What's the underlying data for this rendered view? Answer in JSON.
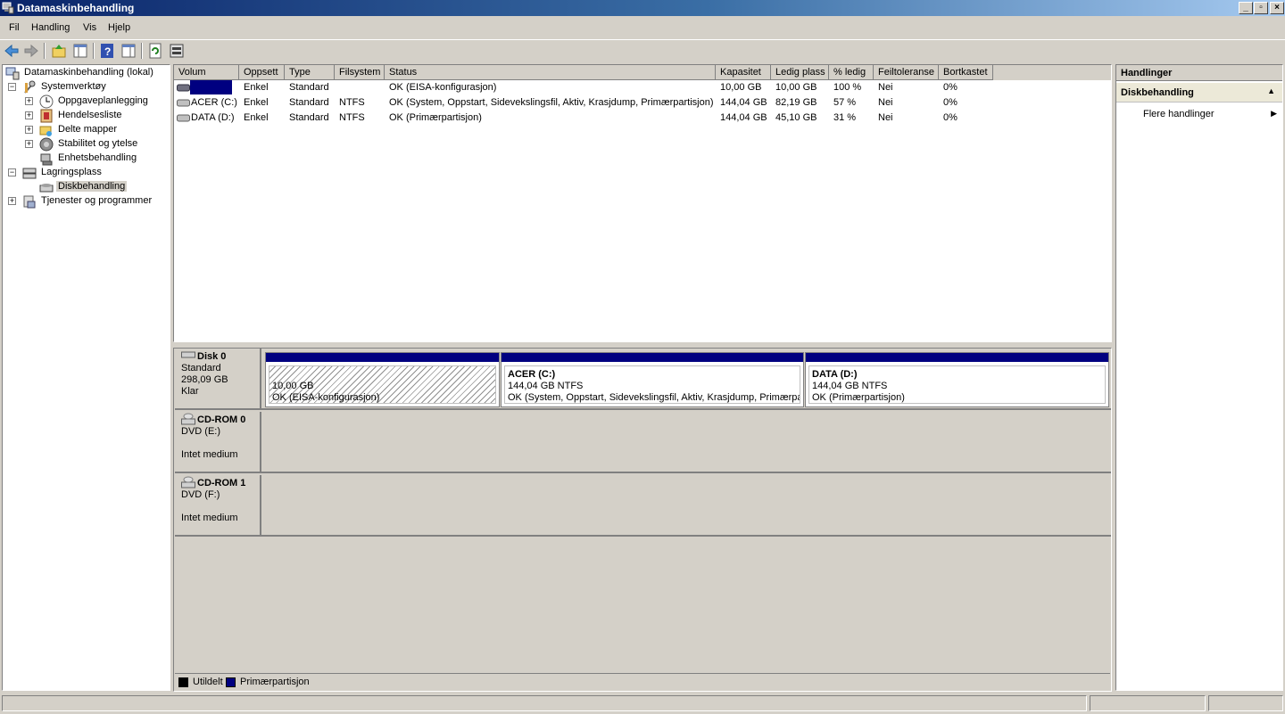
{
  "window": {
    "title": "Datamaskinbehandling"
  },
  "menu": [
    "Fil",
    "Handling",
    "Vis",
    "Hjelp"
  ],
  "tree": {
    "root": "Datamaskinbehandling (lokal)",
    "items": [
      {
        "label": "Systemverktøy",
        "icon": "tools-icon"
      },
      {
        "label": "Oppgaveplanlegging",
        "icon": "clock-icon"
      },
      {
        "label": "Hendelsesliste",
        "icon": "event-log-icon"
      },
      {
        "label": "Delte mapper",
        "icon": "shared-folder-icon"
      },
      {
        "label": "Stabilitet og ytelse",
        "icon": "performance-icon"
      },
      {
        "label": "Enhetsbehandling",
        "icon": "device-manager-icon"
      },
      {
        "label": "Lagringsplass",
        "icon": "storage-icon"
      },
      {
        "label": "Diskbehandling",
        "icon": "disk-management-icon"
      },
      {
        "label": "Tjenester og programmer",
        "icon": "services-icon"
      }
    ]
  },
  "volumes": {
    "columns": [
      "Volum",
      "Oppsett",
      "Type",
      "Filsystem",
      "Status",
      "Kapasitet",
      "Ledig plass",
      "% ledig",
      "Feiltoleranse",
      "Bortkastet"
    ],
    "rows": [
      {
        "volume": "",
        "layout": "Enkel",
        "type": "Standard",
        "fs": "",
        "status": "OK (EISA-konfigurasjon)",
        "capacity": "10,00 GB",
        "free": "10,00 GB",
        "pct": "100 %",
        "ft": "Nei",
        "overhead": "0%"
      },
      {
        "volume": "ACER (C:)",
        "layout": "Enkel",
        "type": "Standard",
        "fs": "NTFS",
        "status": "OK (System, Oppstart, Sidevekslingsfil, Aktiv, Krasjdump, Primærpartisjon)",
        "capacity": "144,04 GB",
        "free": "82,19 GB",
        "pct": "57 %",
        "ft": "Nei",
        "overhead": "0%"
      },
      {
        "volume": "DATA (D:)",
        "layout": "Enkel",
        "type": "Standard",
        "fs": "NTFS",
        "status": "OK (Primærpartisjon)",
        "capacity": "144,04 GB",
        "free": "45,10 GB",
        "pct": "31 %",
        "ft": "Nei",
        "overhead": "0%"
      }
    ]
  },
  "disks": [
    {
      "name": "Disk 0",
      "line1": "Standard",
      "line2": "298,09 GB",
      "line3": "Klar",
      "partitions": [
        {
          "name": "",
          "size": "10,00 GB",
          "status": "OK (EISA-konfigurasjon)"
        },
        {
          "name": "ACER  (C:)",
          "size": "144,04 GB NTFS",
          "status": "OK (System, Oppstart, Sidevekslingsfil, Aktiv, Krasjdump, Primærpa"
        },
        {
          "name": "DATA  (D:)",
          "size": "144,04 GB NTFS",
          "status": "OK (Primærpartisjon)"
        }
      ]
    },
    {
      "name": "CD-ROM 0",
      "line1": "DVD (E:)",
      "line2": "",
      "line3": "Intet medium"
    },
    {
      "name": "CD-ROM 1",
      "line1": "DVD (F:)",
      "line2": "",
      "line3": "Intet medium"
    }
  ],
  "legend": [
    {
      "label": "Utildelt",
      "color": "#000000"
    },
    {
      "label": "Primærpartisjon",
      "color": "#000080"
    }
  ],
  "actions": {
    "header": "Handlinger",
    "section": "Diskbehandling",
    "item": "Flere handlinger"
  },
  "colors": {
    "primary_partition": "#000080",
    "unallocated": "#000000",
    "titlebar": "#0a246a"
  }
}
